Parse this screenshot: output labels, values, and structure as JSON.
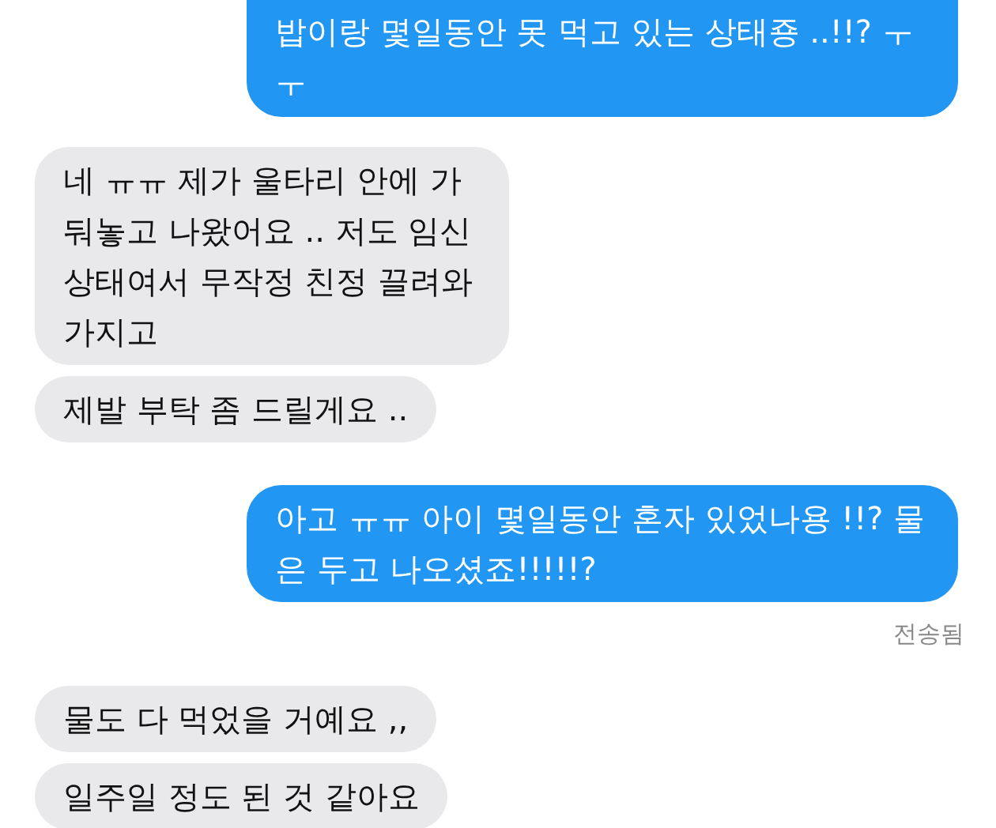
{
  "messages": [
    {
      "kind": "sent",
      "text": "밥이랑 몇일동안 못 먹고 있는 상태죵 ..!!? ㅜㅜ"
    },
    {
      "kind": "received",
      "text": "네 ㅠㅠ 제가 울타리 안에 가둬놓고 나왔어요 .. 저도 임신 상태여서 무작정 친정 끌려와 가지고"
    },
    {
      "kind": "received",
      "text": "제발 부탁 좀 드릴게요 .."
    },
    {
      "kind": "sent",
      "text": "아고 ㅠㅠ 아이 몇일동안 혼자 있었나용 !!? 물은 두고 나오셨죠!!!!!?"
    },
    {
      "kind": "status",
      "text": "전송됨"
    },
    {
      "kind": "received",
      "text": "물도 다 먹었을 거예요 ,,"
    },
    {
      "kind": "received",
      "text": "일주일 정도 된 것 같아요"
    }
  ]
}
